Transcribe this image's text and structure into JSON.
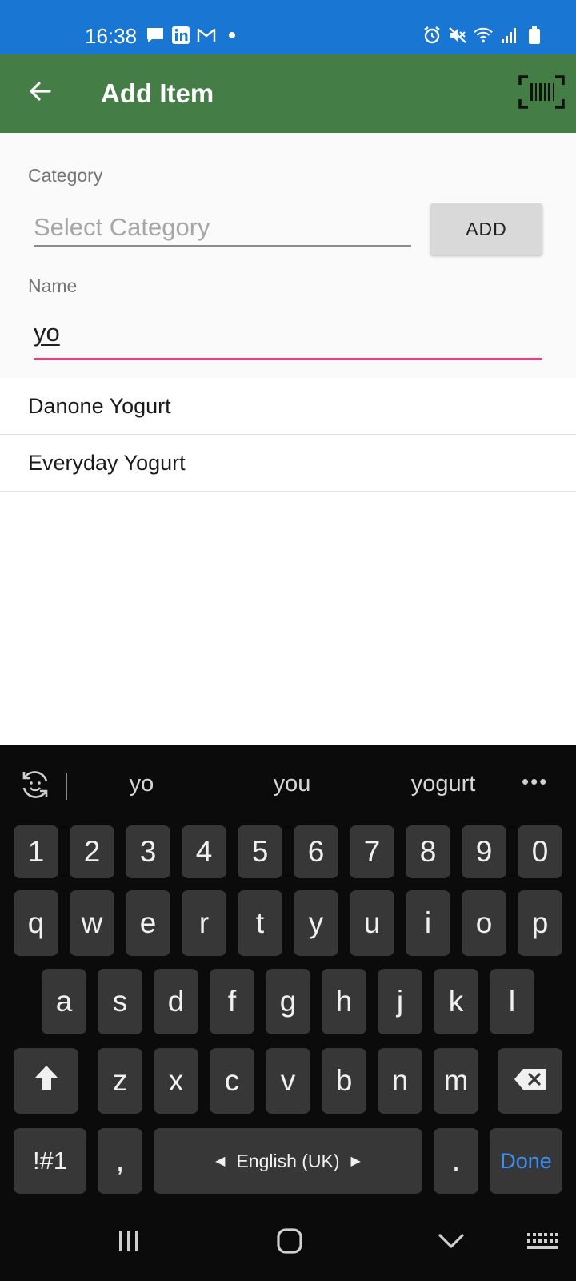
{
  "status_bar": {
    "time": "16:38",
    "left_icons": [
      "message-icon",
      "linkedin-icon",
      "gmail-icon",
      "dot-icon"
    ],
    "right_icons": [
      "alarm-icon",
      "mute-icon",
      "wifi-icon",
      "signal-icon",
      "battery-icon"
    ],
    "background": "#1976d2"
  },
  "app_bar": {
    "title": "Add Item",
    "back_icon": "arrow-left-icon",
    "action_icon": "barcode-scan-icon",
    "background": "#447d46"
  },
  "form": {
    "category_label": "Category",
    "category_placeholder": "Select Category",
    "add_button_label": "ADD",
    "name_label": "Name",
    "name_value": "yo",
    "focus_color": "#e8407d"
  },
  "suggestions": [
    "Danone Yogurt",
    "Everyday Yogurt"
  ],
  "keyboard": {
    "predictions": [
      "yo",
      "you",
      "yogurt"
    ],
    "more_label": "•••",
    "number_row": [
      "1",
      "2",
      "3",
      "4",
      "5",
      "6",
      "7",
      "8",
      "9",
      "0"
    ],
    "row1": [
      "q",
      "w",
      "e",
      "r",
      "t",
      "y",
      "u",
      "i",
      "o",
      "p"
    ],
    "row2": [
      "a",
      "s",
      "d",
      "f",
      "g",
      "h",
      "j",
      "k",
      "l"
    ],
    "row3": [
      "z",
      "x",
      "c",
      "v",
      "b",
      "n",
      "m"
    ],
    "symbols_label": "!#1",
    "comma_label": ",",
    "space_label": "English (UK)",
    "period_label": ".",
    "done_label": "Done",
    "done_color": "#3e8ff0"
  },
  "nav_bar": {
    "icons": [
      "recent-apps-icon",
      "home-icon",
      "back-chevron-icon",
      "keyboard-icon"
    ]
  }
}
